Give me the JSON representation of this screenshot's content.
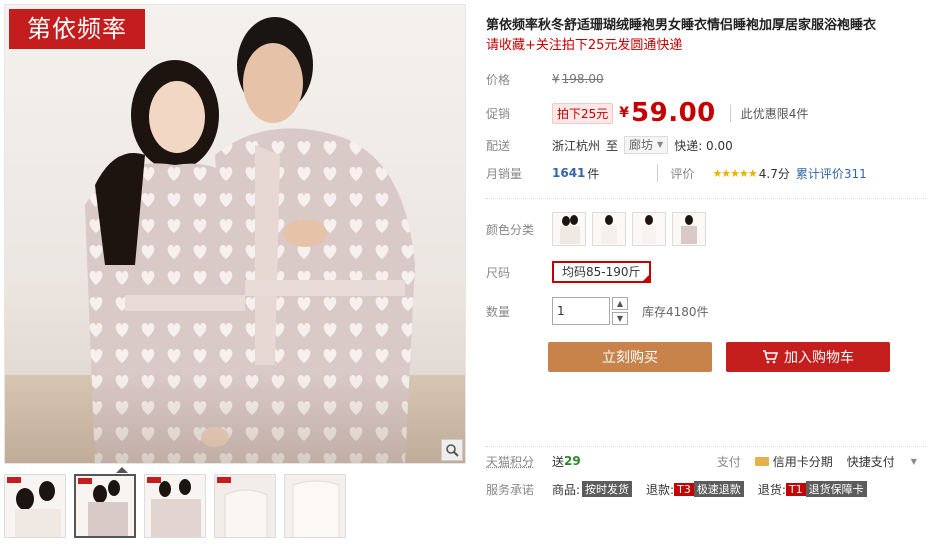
{
  "gallery": {
    "brand_badge": "第依频率"
  },
  "product": {
    "title": "第依频率秋冬舒适珊瑚绒睡袍男女睡衣情侣睡袍加厚居家服浴袍睡衣",
    "subtitle": "请收藏+关注拍下25元发圆通快递"
  },
  "price": {
    "label": "价格",
    "yen": "¥",
    "old": "198.00",
    "promo_label": "促销",
    "promo_tag": "拍下25元",
    "new": "59.00",
    "limit": "此优惠限4件"
  },
  "shipping": {
    "label": "配送",
    "from": "浙江杭州",
    "to_word": "至",
    "to_city": "廊坊",
    "express": "快递: 0.00"
  },
  "sales": {
    "label": "月销量",
    "count": "1641",
    "unit": "件",
    "rating_label": "评价",
    "stars": "★★★★★",
    "score": "4.7分",
    "total_reviews": "累计评价311"
  },
  "color": {
    "label": "颜色分类"
  },
  "size": {
    "label": "尺码",
    "selected": "均码85-190斤"
  },
  "quantity": {
    "label": "数量",
    "value": "1",
    "stock": "库存4180件"
  },
  "actions": {
    "buy": "立刻购买",
    "cart": "加入购物车"
  },
  "points": {
    "label": "天猫积分",
    "give": "送",
    "value": "29",
    "pay_label": "支付",
    "card_pay": "信用卡分期",
    "quick_pay": "快捷支付"
  },
  "service": {
    "label": "服务承诺",
    "goods_label": "商品:",
    "goods_tag": "按时发货",
    "return_label": "退款:",
    "return_code": "T3",
    "return_tag": "极速退款",
    "ship_label": "退货:",
    "ship_code": "T1",
    "ship_tag": "退货保障卡"
  }
}
